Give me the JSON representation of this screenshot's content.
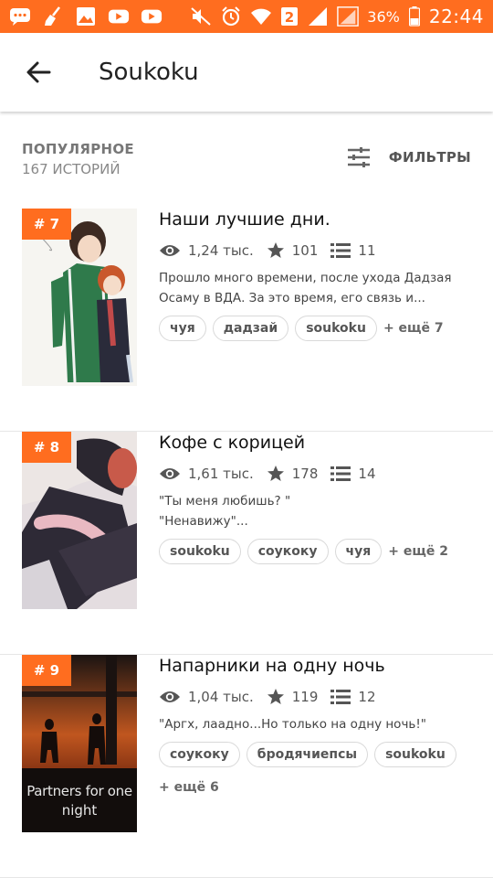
{
  "status_bar": {
    "battery_pct": "36%",
    "time": "22:44",
    "sim_badge": "2",
    "icons": [
      "messaging-icon",
      "broom-icon",
      "gallery-icon",
      "youtube-icon",
      "youtube-icon",
      "mute-icon",
      "alarm-icon",
      "wifi-icon",
      "sim-2-icon",
      "signal-icon",
      "signal-icon",
      "battery-icon"
    ]
  },
  "app_bar": {
    "title": "Soukoku",
    "back_icon": "arrow-left-icon"
  },
  "section": {
    "title": "ПОПУЛЯРНОЕ",
    "count": "167 ИСТОРИЙ",
    "filters_label": "ФИЛЬТРЫ",
    "filters_icon": "sliders-icon"
  },
  "stories": [
    {
      "rank": "# 7",
      "title": "Наши лучшие дни.",
      "reads": "1,24 тыс.",
      "votes": "101",
      "parts": "11",
      "description": "Прошло много времени, после ухода Дадзая Осаму в ВДА. За это время, его связь и...",
      "tags": [
        "чуя",
        "дадзай",
        "soukoku"
      ],
      "more_tags": "+ ещё 7"
    },
    {
      "rank": "# 8",
      "title": "Кофе с корицей",
      "reads": "1,61 тыс.",
      "votes": "178",
      "parts": "14",
      "description": "\"Ты меня любишь? \" \"Ненавижу\"...",
      "tags": [
        "soukoku",
        "соукоку",
        "чуя"
      ],
      "more_tags": "+ ещё 2"
    },
    {
      "rank": "# 9",
      "title": "Напарники на одну ночь",
      "reads": "1,04 тыс.",
      "votes": "119",
      "parts": "12",
      "description": "\"Аргх, лаадно...Но только на одну ночь!\"",
      "tags": [
        "соукоку",
        "бродячиепсы",
        "soukoku"
      ],
      "more_tags": "+ ещё 6",
      "cover_text": [
        "Partners for one",
        "night"
      ]
    }
  ],
  "colors": {
    "accent": "#ff6d1f",
    "text_primary": "#111111",
    "text_secondary": "#555555"
  }
}
